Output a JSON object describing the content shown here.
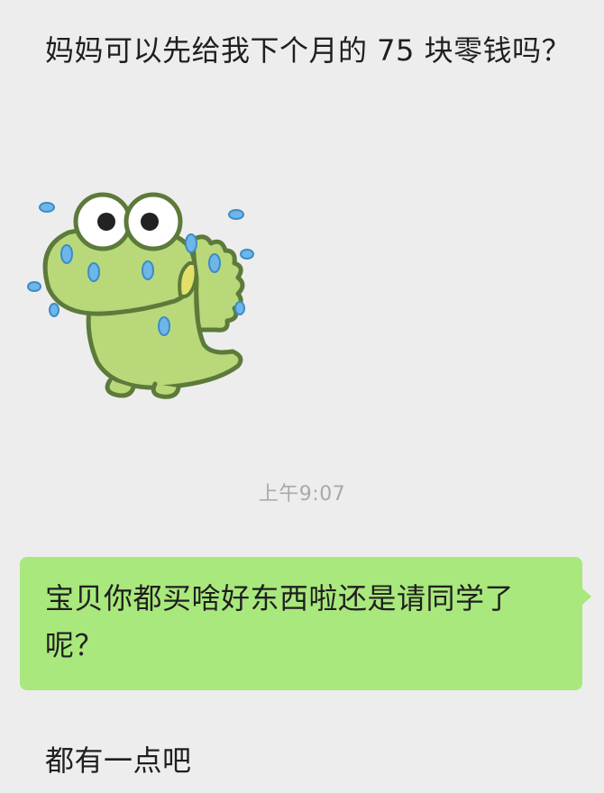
{
  "messages": {
    "incoming_1": "妈妈可以先给我下个月的 75 块零钱吗？",
    "sticker": {
      "icon": "crying-crocodile-sticker-icon",
      "body_color": "#b9d87a",
      "outline_color": "#5c7a3a",
      "tear_color": "#6fb6e8"
    },
    "timestamp": "上午9:07",
    "outgoing_1": "宝贝你都买啥好东西啦还是请同学了呢？",
    "incoming_2": "都有一点吧"
  },
  "colors": {
    "background": "#ededed",
    "outgoing_bubble": "#a9e87c",
    "timestamp_text": "#a9a9a9"
  }
}
